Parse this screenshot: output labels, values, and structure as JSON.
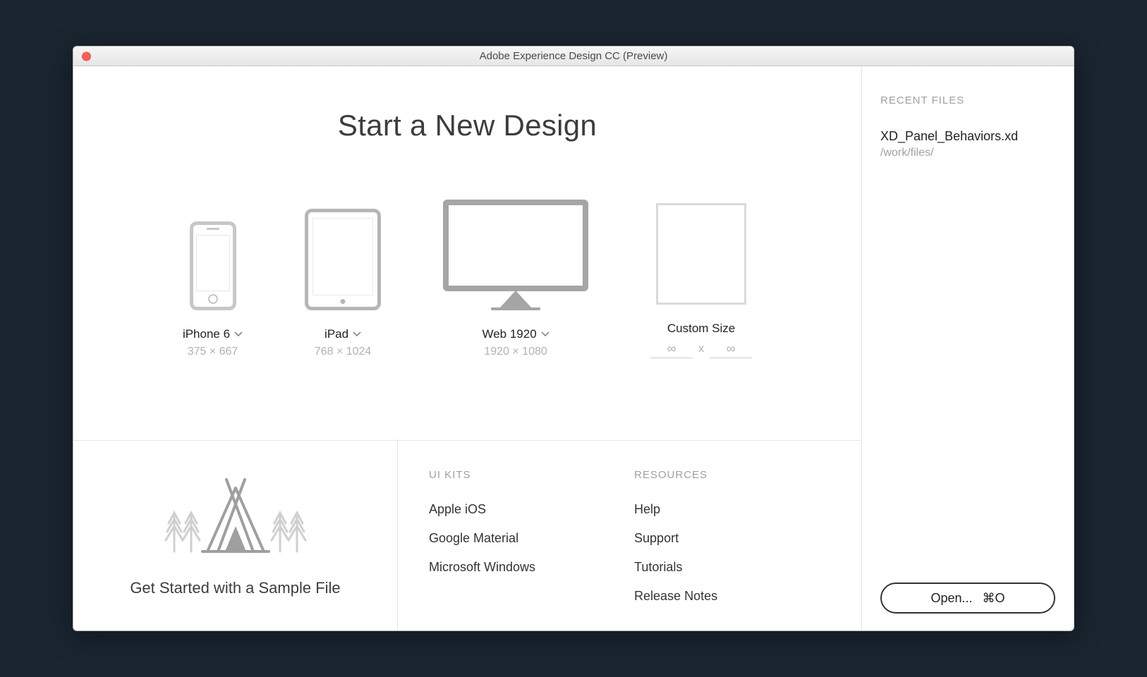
{
  "window": {
    "title": "Adobe Experience Design CC (Preview)"
  },
  "hero": {
    "heading": "Start a New Design"
  },
  "templates": [
    {
      "label": "iPhone 6",
      "dim": "375 × 667",
      "hasDropdown": true
    },
    {
      "label": "iPad",
      "dim": "768 × 1024",
      "hasDropdown": true
    },
    {
      "label": "Web 1920",
      "dim": "1920 × 1080",
      "hasDropdown": true
    },
    {
      "label": "Custom Size",
      "dim": "",
      "hasDropdown": false
    }
  ],
  "customSize": {
    "widthPlaceholder": "∞",
    "heightPlaceholder": "∞",
    "separator": "x"
  },
  "sample": {
    "label": "Get Started with a Sample File"
  },
  "uikits": {
    "heading": "UI KITS",
    "items": [
      "Apple iOS",
      "Google Material",
      "Microsoft Windows"
    ]
  },
  "resources": {
    "heading": "RESOURCES",
    "items": [
      "Help",
      "Support",
      "Tutorials",
      "Release Notes"
    ]
  },
  "recent": {
    "heading": "RECENT FILES",
    "files": [
      {
        "name": "XD_Panel_Behaviors.xd",
        "path": "/work/files/"
      }
    ]
  },
  "openButton": {
    "label": "Open...",
    "shortcut": "⌘O"
  }
}
